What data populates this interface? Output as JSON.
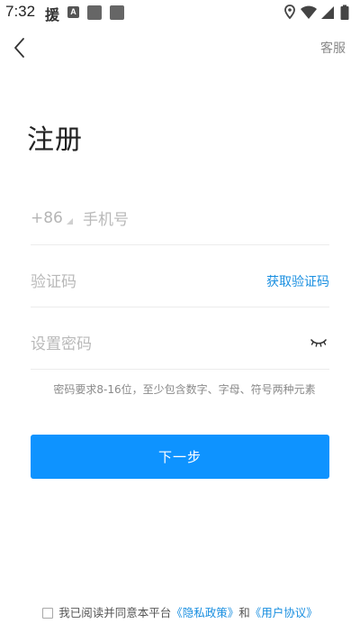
{
  "status_bar": {
    "time": "7:32",
    "app_glyph": "援",
    "a_badge": "A",
    "icons": [
      "location-icon",
      "wifi-icon",
      "signal-icon",
      "battery-icon"
    ]
  },
  "header": {
    "service_label": "客服"
  },
  "page": {
    "title": "注册"
  },
  "form": {
    "country_code": "+86",
    "phone_placeholder": "手机号",
    "code_placeholder": "验证码",
    "get_code_label": "获取验证码",
    "password_placeholder": "设置密码",
    "password_hint": "密码要求8-16位，至少包含数字、字母、符号两种元素",
    "next_label": "下一步"
  },
  "agreement": {
    "prefix": "我已阅读并同意本平台",
    "privacy_link": "《隐私政策》",
    "conjunction": "和",
    "user_link": "《用户协议》"
  },
  "colors": {
    "accent": "#0e93ff",
    "link": "#1a8fe0",
    "placeholder": "#b9b9b9"
  }
}
